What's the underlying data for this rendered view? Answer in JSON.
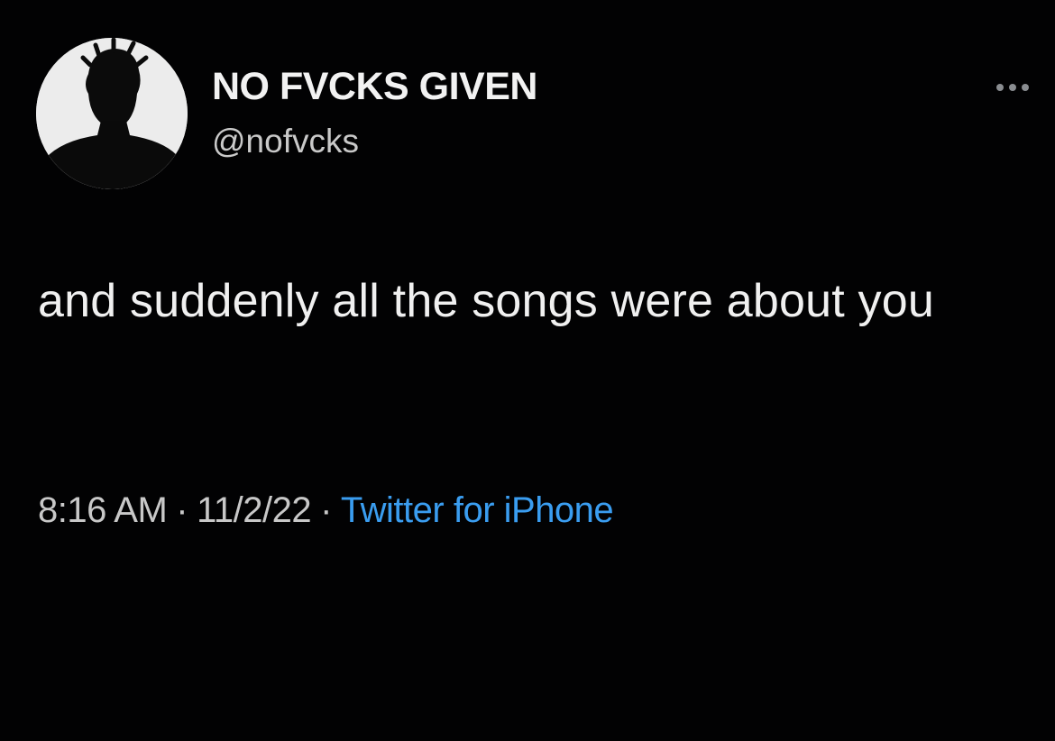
{
  "tweet": {
    "author": {
      "display_name": "NO FVCKS GIVEN",
      "handle": "@nofvcks",
      "avatar_icon": "silhouette-avatar-icon"
    },
    "more_icon": "more-options-icon",
    "text": "and suddenly all the songs were about you",
    "time": "8:16 AM",
    "separator": "·",
    "date": "11/2/22",
    "source": "Twitter for iPhone",
    "colors": {
      "background": "#020203",
      "text": "#f0f0f0",
      "muted": "#c8c8c8",
      "link": "#3a9df0"
    }
  }
}
